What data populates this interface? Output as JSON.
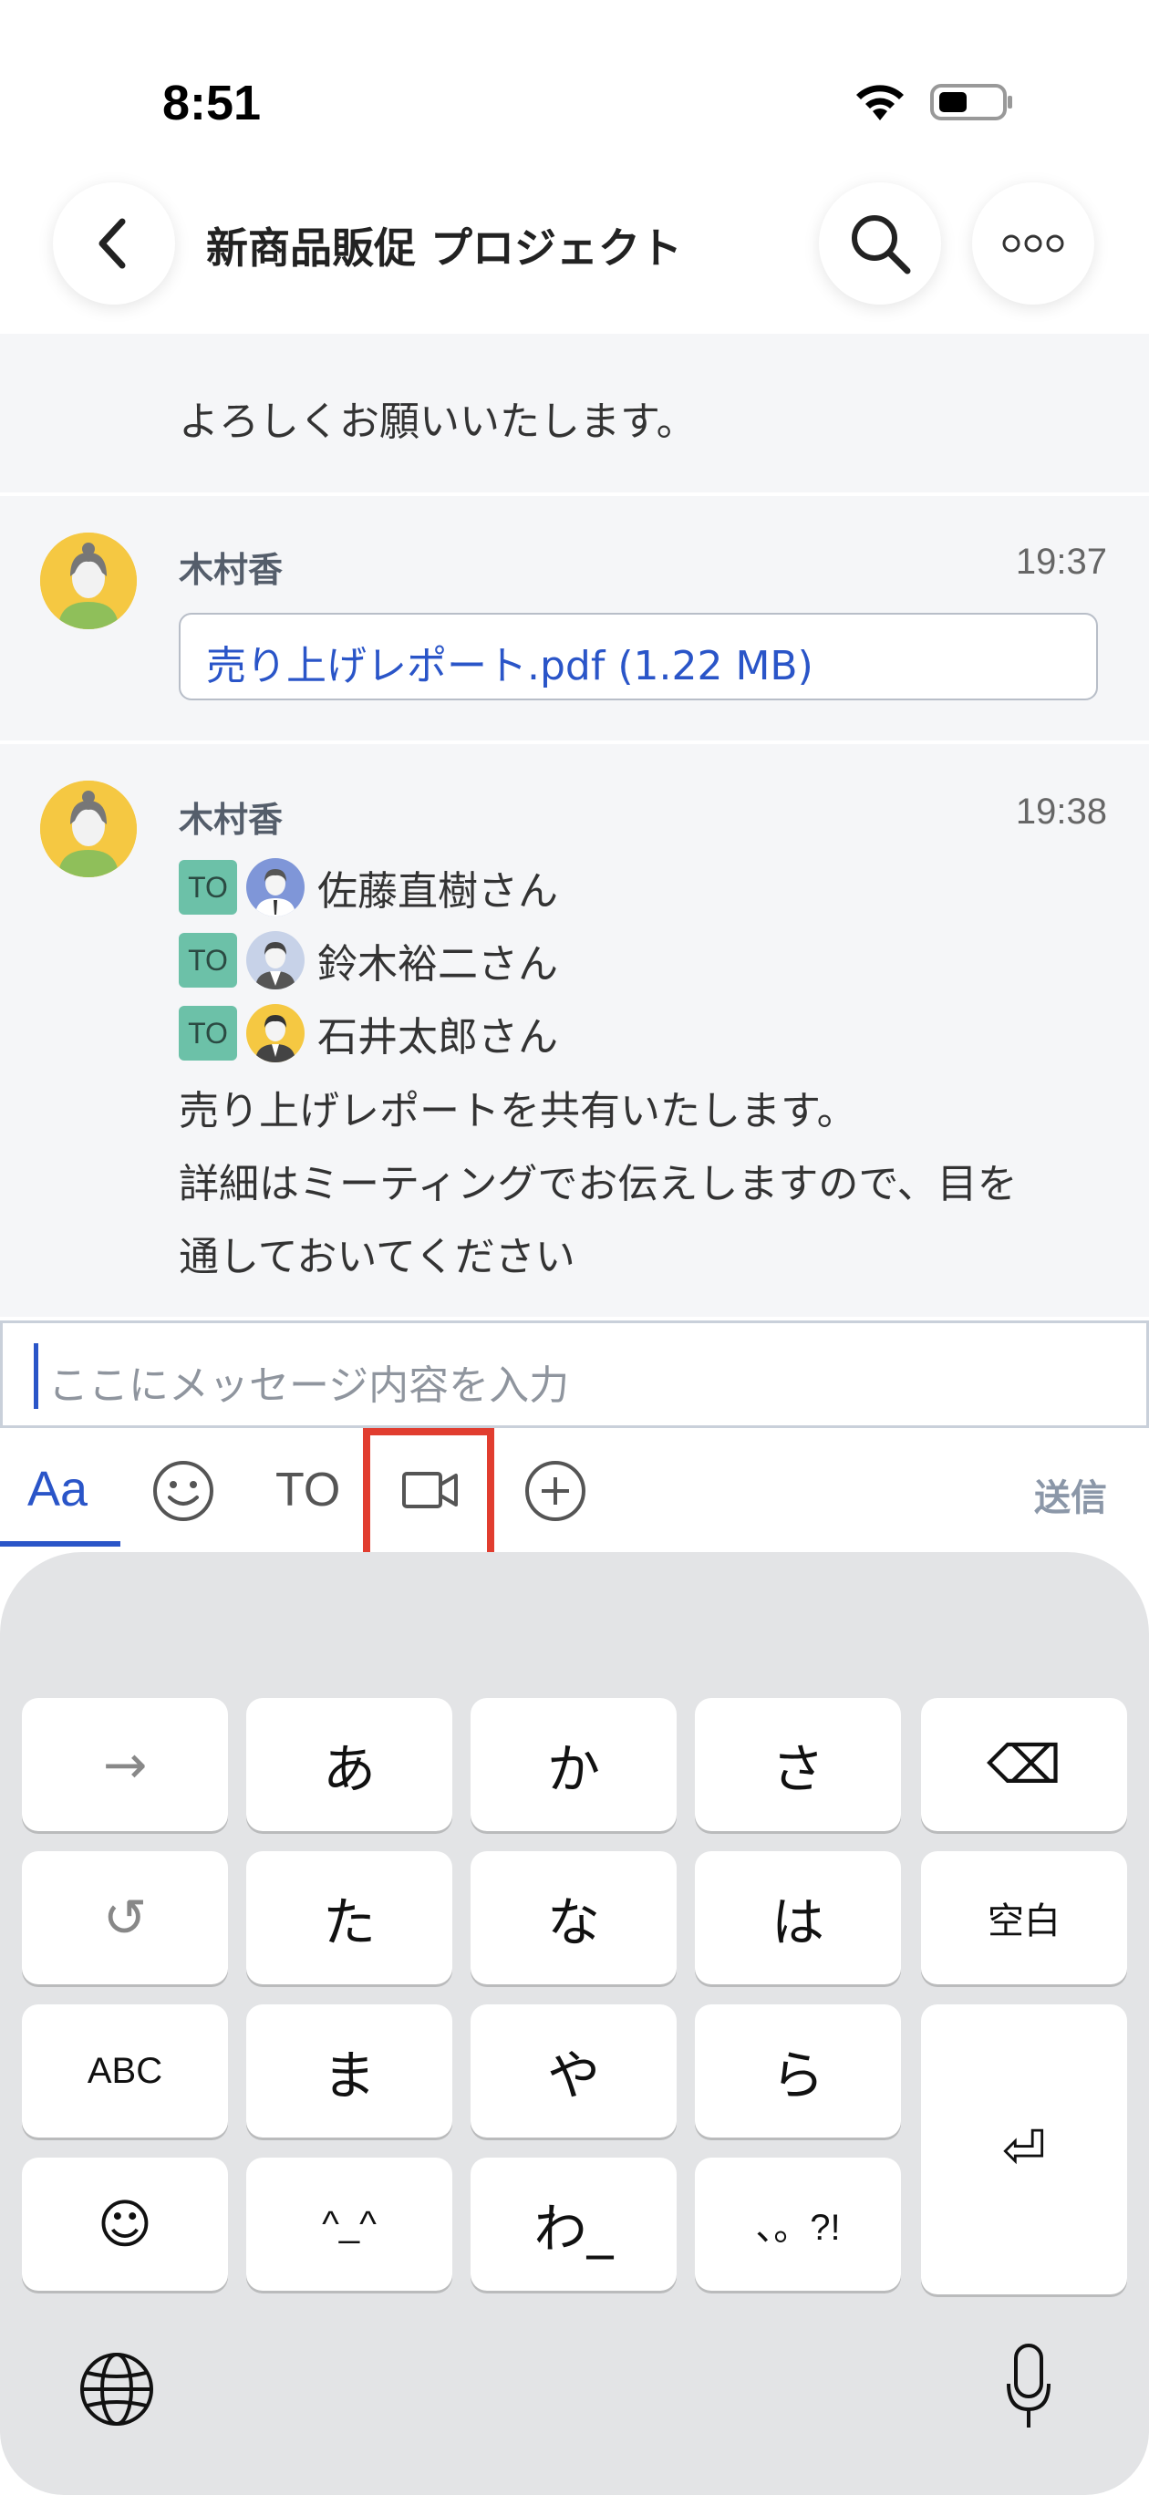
{
  "status_bar": {
    "time": "8:51"
  },
  "header": {
    "title": "新商品販促 プロジェクト"
  },
  "messages": {
    "previous_text": "よろしくお願いいたします。",
    "msg1": {
      "sender": "木村香",
      "time": "19:37",
      "file": "売り上げレポート.pdf (1.22 MB)"
    },
    "msg2": {
      "sender": "木村香",
      "time": "19:38",
      "to_label": "TO",
      "recipients": [
        "佐藤直樹さん",
        "鈴木裕二さん",
        "石井太郎さん"
      ],
      "lines": [
        "売り上げレポートを共有いたします。",
        "詳細はミーティングでお伝えしますので、目を",
        "通しておいてください"
      ]
    }
  },
  "input": {
    "placeholder": "ここにメッセージ内容を入力"
  },
  "toolbar": {
    "format_label": "Aa",
    "to_label": "TO",
    "send_label": "送信"
  },
  "keyboard": {
    "rows": [
      [
        "→",
        "あ",
        "か",
        "さ",
        "⌫"
      ],
      [
        "↺",
        "た",
        "な",
        "は",
        "空白"
      ],
      [
        "ABC",
        "ま",
        "や",
        "ら",
        "⏎"
      ],
      [
        "☺",
        "^_^",
        "わ_",
        "、。?!"
      ]
    ]
  },
  "colors": {
    "accent": "#2a55c8",
    "to_badge": "#6cc1a8",
    "highlight": "#e13d2f"
  }
}
